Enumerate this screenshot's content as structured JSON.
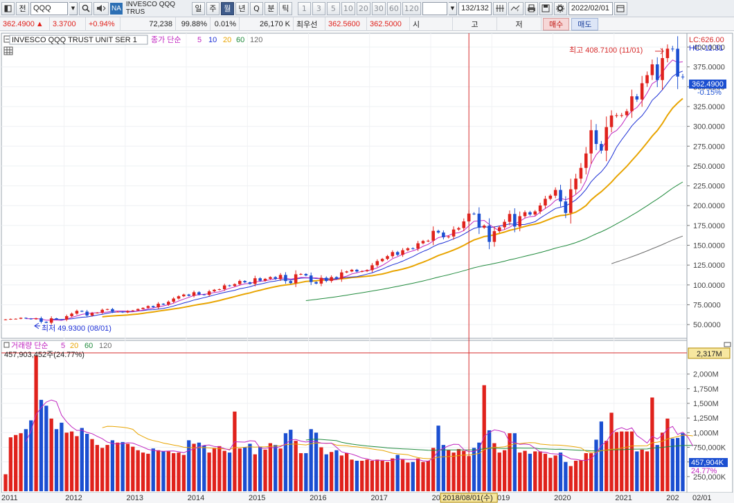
{
  "toolbar": {
    "period_label": "전",
    "symbol": "QQQ",
    "market_badge": "NA",
    "instrument_short": "INVESCO QQQ TRUS",
    "timeframes": [
      "일",
      "주",
      "월",
      "년",
      "Q",
      "분",
      "틱"
    ],
    "active_timeframe": "월",
    "intervals": [
      "1",
      "3",
      "5",
      "10",
      "20",
      "30",
      "60",
      "120"
    ],
    "bar_count": "132/132",
    "date": "2022/02/01"
  },
  "quote": {
    "price": "362.4900",
    "change_arrow": "▲",
    "change": "3.3700",
    "change_pct": "+0.94%",
    "volume": "72,238",
    "volume_ratio": "99.88%",
    "turnover": "0.01%",
    "amount": "26,170 K",
    "best_quote_label": "최우선",
    "best_ask": "362.5600",
    "best_bid": "362.5000",
    "open_label": "시",
    "high_label": "고",
    "low_label": "저",
    "buy_label": "매수",
    "sell_label": "매도"
  },
  "price_panel": {
    "instrument": "INVESCO QQQ TRUST UNIT SER 1",
    "ma_label": "종가 단순",
    "ma_periods": [
      "5",
      "10",
      "20",
      "60",
      "120"
    ],
    "lc": "LC:626.00",
    "hc": "HC:-11.31",
    "high_marker": "최고 408.7100 (11/01)",
    "low_marker": "최저 49.9300 (08/01)",
    "current_price_tag": "362.4900",
    "current_change_tag": "-0.15%",
    "y_labels": [
      "400.0000",
      "375.0000",
      "350.0000",
      "325.0000",
      "300.0000",
      "275.0000",
      "250.0000",
      "225.0000",
      "200.0000",
      "175.0000",
      "150.0000",
      "125.0000",
      "100.0000",
      "75.0000",
      "50.0000"
    ]
  },
  "volume_panel": {
    "label": "거래량 단순",
    "ma_periods": [
      "5",
      "20",
      "60",
      "120"
    ],
    "readout": "457,903,452주(24.77%)",
    "max_tag": "2,317M",
    "current_tag": "457,904K",
    "current_pct_tag": "24.77%",
    "y_labels": [
      "2,000M",
      "1,750M",
      "1,500M",
      "1,250M",
      "1,000M",
      "750,000K",
      "500,000K",
      "250,000K"
    ]
  },
  "x_axis": {
    "labels": [
      "2011",
      "2012",
      "2013",
      "2014",
      "2015",
      "2016",
      "2017",
      "2018",
      "2019",
      "2020",
      "2021",
      "202",
      "02/01"
    ],
    "crosshair_tag": "2018/08/01(수)"
  },
  "colors": {
    "up": "#e0221c",
    "down": "#1b4fd1",
    "ma5": "#c026c0",
    "ma10": "#1c2fd6",
    "ma20": "#e8a400",
    "ma60": "#1f8a3c",
    "ma120": "#6b6b6b",
    "crosshair": "#d62a2a"
  },
  "chart_data": {
    "type": "candlestick",
    "x": [
      "2011-01",
      "2011-02",
      "2011-03",
      "2011-04",
      "2011-05",
      "2011-06",
      "2011-07",
      "2011-08",
      "2011-09",
      "2011-10",
      "2011-11",
      "2011-12",
      "2012-01",
      "2012-02",
      "2012-03",
      "2012-04",
      "2012-05",
      "2012-06",
      "2012-07",
      "2012-08",
      "2012-09",
      "2012-10",
      "2012-11",
      "2012-12",
      "2013-01",
      "2013-02",
      "2013-03",
      "2013-04",
      "2013-05",
      "2013-06",
      "2013-07",
      "2013-08",
      "2013-09",
      "2013-10",
      "2013-11",
      "2013-12",
      "2014-01",
      "2014-02",
      "2014-03",
      "2014-04",
      "2014-05",
      "2014-06",
      "2014-07",
      "2014-08",
      "2014-09",
      "2014-10",
      "2014-11",
      "2014-12",
      "2015-01",
      "2015-02",
      "2015-03",
      "2015-04",
      "2015-05",
      "2015-06",
      "2015-07",
      "2015-08",
      "2015-09",
      "2015-10",
      "2015-11",
      "2015-12",
      "2016-01",
      "2016-02",
      "2016-03",
      "2016-04",
      "2016-05",
      "2016-06",
      "2016-07",
      "2016-08",
      "2016-09",
      "2016-10",
      "2016-11",
      "2016-12",
      "2017-01",
      "2017-02",
      "2017-03",
      "2017-04",
      "2017-05",
      "2017-06",
      "2017-07",
      "2017-08",
      "2017-09",
      "2017-10",
      "2017-11",
      "2017-12",
      "2018-01",
      "2018-02",
      "2018-03",
      "2018-04",
      "2018-05",
      "2018-06",
      "2018-07",
      "2018-08",
      "2018-09",
      "2018-10",
      "2018-11",
      "2018-12",
      "2019-01",
      "2019-02",
      "2019-03",
      "2019-04",
      "2019-05",
      "2019-06",
      "2019-07",
      "2019-08",
      "2019-09",
      "2019-10",
      "2019-11",
      "2019-12",
      "2020-01",
      "2020-02",
      "2020-03",
      "2020-04",
      "2020-05",
      "2020-06",
      "2020-07",
      "2020-08",
      "2020-09",
      "2020-10",
      "2020-11",
      "2020-12",
      "2021-01",
      "2021-02",
      "2021-03",
      "2021-04",
      "2021-05",
      "2021-06",
      "2021-07",
      "2021-08",
      "2021-09",
      "2021-10",
      "2021-11",
      "2021-12",
      "2022-01",
      "2022-02"
    ],
    "close": [
      56.5,
      57.1,
      57.3,
      58.5,
      57.6,
      56.7,
      58.0,
      53.5,
      52.3,
      57.9,
      56.6,
      56.2,
      60.6,
      63.8,
      67.3,
      66.3,
      61.4,
      64.5,
      65.1,
      68.6,
      69.5,
      66.1,
      66.2,
      65.3,
      67.2,
      67.8,
      69.6,
      71.1,
      73.3,
      71.8,
      76.3,
      75.2,
      78.8,
      82.8,
      85.7,
      87.9,
      86.3,
      90.8,
      88.0,
      87.5,
      91.9,
      93.9,
      94.6,
      99.4,
      98.7,
      101.0,
      105.0,
      103.3,
      101.3,
      108.4,
      105.3,
      107.7,
      109.9,
      107.4,
      112.6,
      104.9,
      102.3,
      113.4,
      113.8,
      111.9,
      103.6,
      101.7,
      109.0,
      105.0,
      109.9,
      107.6,
      115.8,
      117.0,
      119.1,
      116.9,
      117.3,
      118.7,
      124.8,
      130.0,
      132.8,
      136.3,
      141.4,
      138.0,
      143.8,
      146.2,
      145.8,
      152.5,
      155.4,
      155.8,
      168.2,
      166.1,
      160.1,
      161.1,
      169.9,
      171.7,
      180.1,
      190.0,
      189.9,
      172.2,
      174.8,
      154.3,
      167.8,
      172.7,
      179.6,
      189.5,
      173.6,
      186.7,
      191.7,
      188.8,
      192.7,
      200.2,
      208.6,
      212.6,
      219.8,
      205.3,
      190.8,
      220.6,
      234.1,
      247.6,
      265.8,
      295.1,
      277.8,
      269.4,
      299.1,
      313.7,
      314.0,
      314.1,
      319.1,
      337.9,
      333.9,
      354.4,
      364.6,
      378.2,
      358.4,
      386.1,
      398.0,
      397.9,
      362.8,
      362.5
    ],
    "volume_millions": [
      290,
      920,
      960,
      990,
      1060,
      1210,
      2317,
      1560,
      1460,
      1240,
      1060,
      1170,
      1000,
      1020,
      940,
      1080,
      980,
      890,
      790,
      740,
      790,
      870,
      830,
      840,
      810,
      760,
      700,
      660,
      640,
      730,
      700,
      680,
      680,
      650,
      660,
      620,
      870,
      810,
      830,
      780,
      660,
      740,
      770,
      690,
      660,
      1360,
      730,
      750,
      810,
      630,
      760,
      710,
      820,
      790,
      730,
      990,
      1050,
      860,
      650,
      650,
      1060,
      1000,
      750,
      630,
      670,
      700,
      610,
      650,
      540,
      520,
      520,
      540,
      520,
      540,
      520,
      500,
      560,
      620,
      540,
      490,
      500,
      560,
      500,
      520,
      740,
      1120,
      790,
      700,
      660,
      720,
      690,
      600,
      740,
      830,
      1810,
      1040,
      820,
      660,
      700,
      990,
      990,
      660,
      690,
      640,
      680,
      680,
      640,
      570,
      610,
      660,
      500,
      430,
      520,
      530,
      650,
      650,
      880,
      1190,
      860,
      1340,
      1010,
      1020,
      1020,
      1020,
      680,
      710,
      680,
      1600,
      790,
      1000,
      1240,
      900,
      910,
      990,
      590,
      460
    ]
  }
}
